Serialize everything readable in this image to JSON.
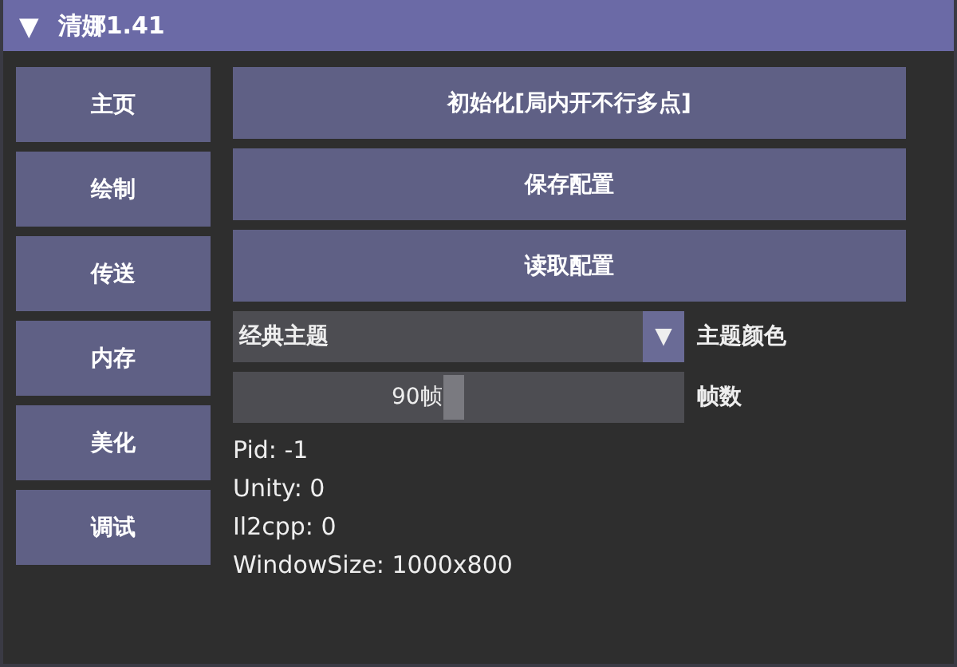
{
  "window": {
    "title": "清娜1.41",
    "collapse_glyph": "▼"
  },
  "sidebar": {
    "items": [
      {
        "label": "主页",
        "selected": false
      },
      {
        "label": "绘制",
        "selected": false
      },
      {
        "label": "传送",
        "selected": false
      },
      {
        "label": "内存",
        "selected": false
      },
      {
        "label": "美化",
        "selected": false
      },
      {
        "label": "调试",
        "selected": false
      }
    ]
  },
  "buttons": [
    "初始化[局内开不行多点]",
    "保存配置",
    "读取配置"
  ],
  "theme_combo": {
    "value": "经典主题",
    "arrow": "▼",
    "label": "主题颜色"
  },
  "fps_slider": {
    "reading": "90帧",
    "level": 0.49,
    "label": "帧数"
  },
  "info": [
    "Pid: -1",
    "Unity: 0",
    "Il2cpp: 0",
    "WindowSize: 1000x800"
  ]
}
